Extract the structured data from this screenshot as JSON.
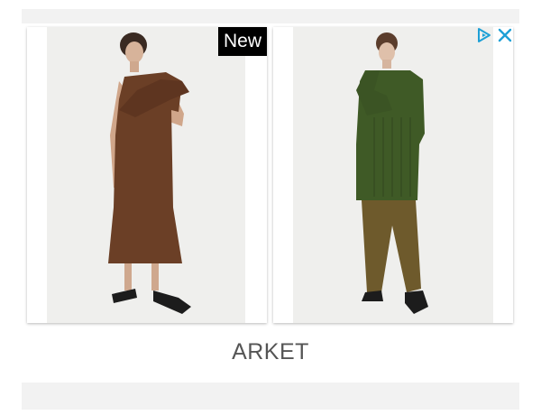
{
  "ad": {
    "badge_label": "New",
    "brand": "ARKET",
    "colors": {
      "accent": "#1ea0d6",
      "badge_bg": "#000000",
      "brand_text": "#555555",
      "dress_brown": "#6b3f26",
      "sweater_green": "#3f5a26",
      "trousers_olive": "#6e5a2c"
    },
    "icons": [
      "adchoices-icon",
      "close-icon"
    ]
  }
}
